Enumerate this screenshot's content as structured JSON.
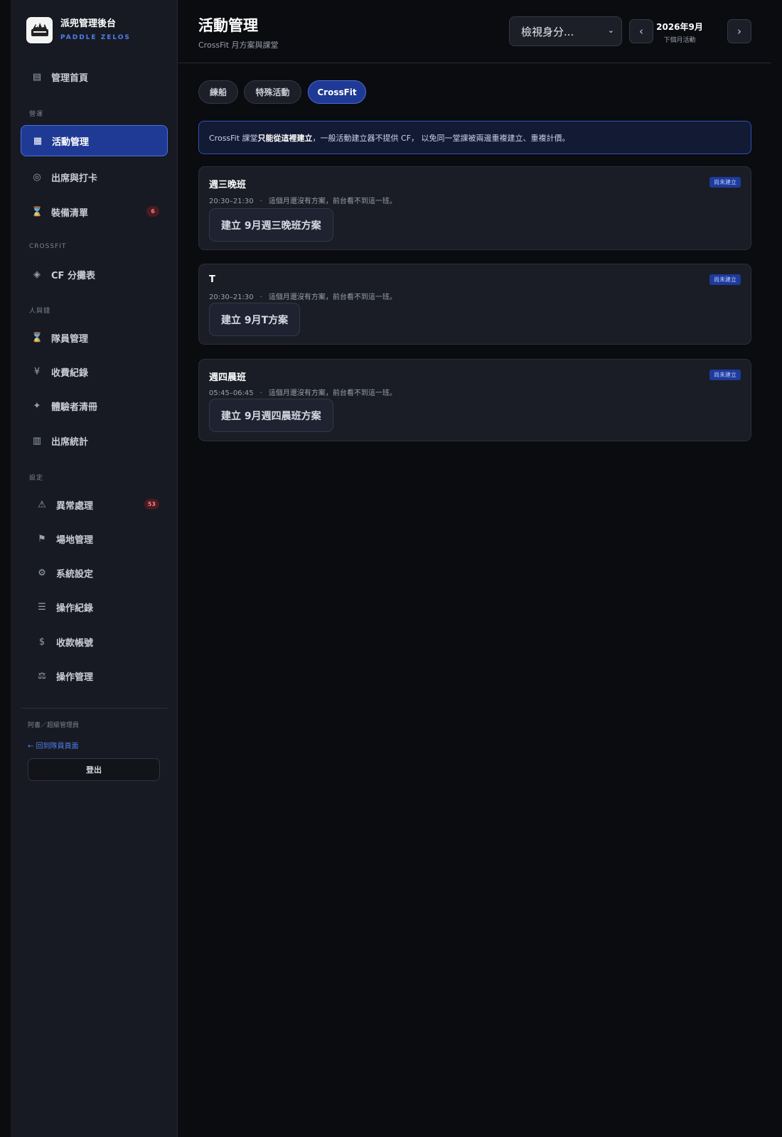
{
  "brand": {
    "title": "派兜管理後台",
    "subtitle": "PADDLE ZELOS",
    "logo_icon": "paddle-logo-icon"
  },
  "sidebar": {
    "home": {
      "label": "管理首頁",
      "icon": "list-icon"
    },
    "sections": {
      "ops": "營運",
      "crossfit": "CROSSFIT",
      "people": "人與錢",
      "settings": "設定"
    },
    "items": [
      {
        "label": "活動管理",
        "icon": "grid-icon",
        "active": true
      },
      {
        "label": "出席與打卡",
        "icon": "target-icon"
      },
      {
        "label": "裝備清單",
        "icon": "hourglass-icon",
        "badge": "6"
      },
      {
        "label": "CF 分攤表",
        "icon": "diamond-icon"
      },
      {
        "label": "隊員管理",
        "icon": "hourglass-icon"
      },
      {
        "label": "收費紀錄",
        "icon": "yen-icon"
      },
      {
        "label": "體驗者清冊",
        "icon": "sparkle-icon"
      },
      {
        "label": "出席統計",
        "icon": "columns-icon"
      },
      {
        "label": "異常處理",
        "icon": "warning-icon",
        "badge": "53"
      },
      {
        "label": "場地管理",
        "icon": "flag-icon"
      },
      {
        "label": "系統設定",
        "icon": "gear-icon"
      },
      {
        "label": "操作紀錄",
        "icon": "menu-lines-icon"
      },
      {
        "label": "收款帳號",
        "icon": "dollar-icon"
      },
      {
        "label": "操作管理",
        "icon": "scale-icon"
      }
    ],
    "user": "阿書／超級管理員",
    "back_link": "← 回到隊員頁面",
    "logout": "登出"
  },
  "header": {
    "title": "活動管理",
    "subtitle": "CrossFit 月方案與課堂",
    "identity_select": "檢視身分...",
    "month": "2026年9月",
    "month_sub": "下個月活動"
  },
  "tabs": [
    {
      "label": "練船"
    },
    {
      "label": "特殊活動"
    },
    {
      "label": "CrossFit",
      "active": true
    }
  ],
  "notice": {
    "prefix": "CrossFit 課堂",
    "bold": "只能從這裡建立",
    "suffix": "，一般活動建立器不提供 CF， 以免同一堂課被兩邊重複建立、重複計價。"
  },
  "cards": [
    {
      "title": "週三晚班",
      "badge": "尚未建立",
      "time": "20:30–21:30",
      "dot": "·",
      "note": "這個月還沒有方案，前台看不到這一班。",
      "button": "建立 9月週三晚班方案"
    },
    {
      "title": "T",
      "badge": "尚未建立",
      "time": "20:30–21:30",
      "dot": "·",
      "note": "這個月還沒有方案，前台看不到這一班。",
      "button": "建立 9月T方案"
    },
    {
      "title": "週四晨班",
      "badge": "尚未建立",
      "time": "05:45–06:45",
      "dot": "·",
      "note": "這個月還沒有方案，前台看不到這一班。",
      "button": "建立 9月週四晨班方案"
    }
  ],
  "colors": {
    "accent": "#4f7df0",
    "active_bg": "#1f3a94",
    "badge_red": "#ff7b86",
    "page_bg": "#0b0c10"
  }
}
